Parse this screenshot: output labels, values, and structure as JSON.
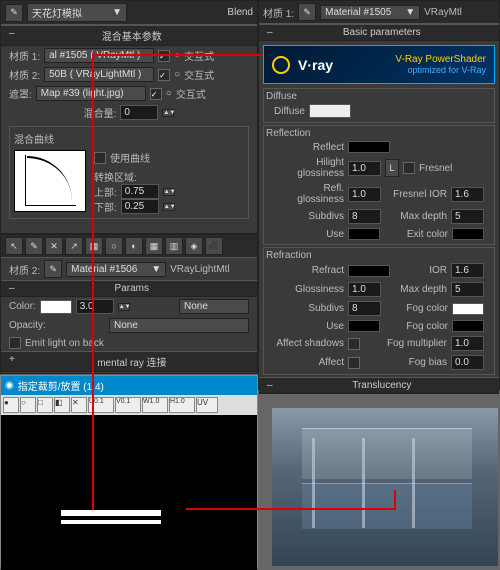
{
  "topLeft": {
    "title": "天花灯模拟",
    "blend": "Blend",
    "section1": "混合基本参数",
    "mat1_lbl": "材质 1:",
    "mat1_val": "al #1505 ( VRayMtl )",
    "mat2_lbl": "材质 2:",
    "mat2_val": "50B  ( VRayLightMtl )",
    "mask_lbl": "遮罩:",
    "mask_val": "Map #39 (light.jpg)",
    "interactive": "交互式",
    "mix_amount_lbl": "混合量:",
    "mix_amount_val": "0",
    "curve_title": "混合曲线",
    "use_curve": "使用曲线",
    "transition": "转换区域:",
    "upper_lbl": "上部:",
    "upper_val": "0.75",
    "lower_lbl": "下部:",
    "lower_val": "0.25"
  },
  "midLeft": {
    "mat_lbl": "材质 2:",
    "mat_name": "Material #1506",
    "mat_type": "VRayLightMtl",
    "params": "Params",
    "color_lbl": "Color:",
    "color_val": "3.0",
    "color_map": "None",
    "opacity_lbl": "Opacity:",
    "opacity_val": "None",
    "emit_lbl": "Emit light on back",
    "mental": "mental ray 连接"
  },
  "topRight": {
    "mat_lbl": "材质 1:",
    "mat_name": "Material #1505",
    "mat_type": "VRayMtl",
    "basic": "Basic parameters",
    "vray_text": "V·ray",
    "vray_ps1": "V-Ray PowerShader",
    "vray_ps2": "optimized for V-Ray",
    "diffuse_section": "Diffuse",
    "diffuse_lbl": "Diffuse",
    "reflection_section": "Reflection",
    "reflect_lbl": "Reflect",
    "hglossy_lbl": "Hilight glossiness",
    "hglossy_val": "1.0",
    "l_btn": "L",
    "fresnel_lbl": "Fresnel",
    "rglossy_lbl": "Refl. glossiness",
    "rglossy_val": "1.0",
    "fresnel_ior_lbl": "Fresnel IOR",
    "fresnel_ior_val": "1.6",
    "subdivs_lbl": "Subdivs",
    "subdivs_val": "8",
    "maxdepth_lbl": "Max depth",
    "maxdepth_val": "5",
    "use_lbl": "Use",
    "exit_lbl": "Exit color",
    "refraction_section": "Refraction",
    "refract_lbl": "Refract",
    "ior_lbl": "IOR",
    "ior_val": "1.6",
    "glossy_lbl": "Glossiness",
    "glossy_val": "1.0",
    "maxdepth2_val": "5",
    "subdivs2_val": "8",
    "fogcolor_lbl": "Fog color",
    "affect_shadows_lbl": "Affect shadows",
    "fogmult_lbl": "Fog multiplier",
    "fogmult_val": "1.0",
    "affect_lbl": "Affect",
    "fogbias_lbl": "Fog bias",
    "fogbias_val": "0.0",
    "translucency": "Translucency"
  },
  "bottomLeft": {
    "title": "指定裁剪/放置 (1:4)",
    "uv_label": "UV"
  }
}
